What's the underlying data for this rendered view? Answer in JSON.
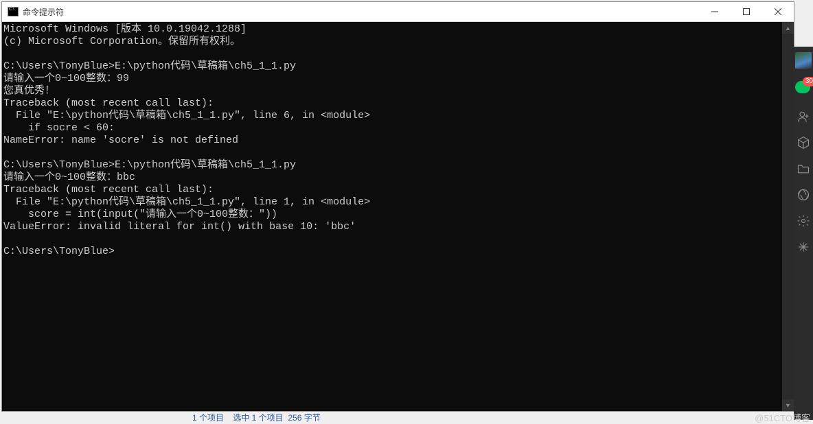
{
  "window": {
    "title": "命令提示符",
    "buttons": {
      "min": "minimize",
      "max": "maximize",
      "close": "close"
    }
  },
  "console_lines": [
    "Microsoft Windows [版本 10.0.19042.1288]",
    "(c) Microsoft Corporation。保留所有权利。",
    "",
    "C:\\Users\\TonyBlue>E:\\python代码\\草稿箱\\ch5_1_1.py",
    "请输入一个0~100整数：99",
    "您真优秀！",
    "Traceback (most recent call last):",
    "  File \"E:\\python代码\\草稿箱\\ch5_1_1.py\", line 6, in <module>",
    "    if socre < 60:",
    "NameError: name 'socre' is not defined",
    "",
    "C:\\Users\\TonyBlue>E:\\python代码\\草稿箱\\ch5_1_1.py",
    "请输入一个0~100整数：bbc",
    "Traceback (most recent call last):",
    "  File \"E:\\python代码\\草稿箱\\ch5_1_1.py\", line 1, in <module>",
    "    score = int(input(\"请输入一个0~100整数：\"))",
    "ValueError: invalid literal for int() with base 10: 'bbc'",
    "",
    "C:\\Users\\TonyBlue>"
  ],
  "dock": {
    "badge_count": "30"
  },
  "watermark": "@51CTO博客",
  "bottom_strip": "1 个项目    选中 1 个项目  256 字节"
}
